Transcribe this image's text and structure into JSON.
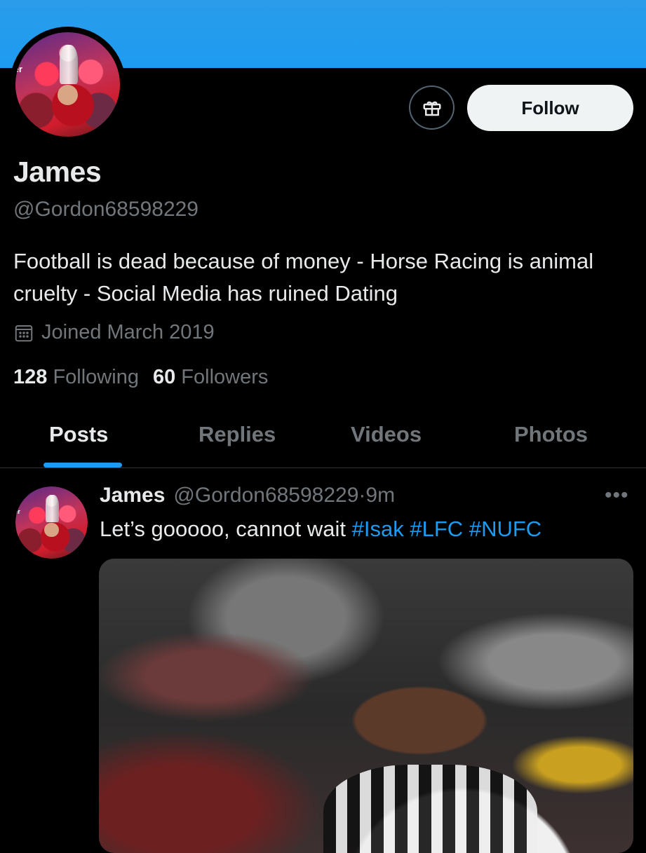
{
  "profile": {
    "name": "James",
    "handle": "@Gordon68598229",
    "bio": "Football is dead because of money - Horse Racing is animal cruelty - Social Media has ruined Dating",
    "joined": "Joined March 2019",
    "following_count": "128",
    "following_label": "Following",
    "followers_count": "60",
    "followers_label": "Followers",
    "follow_button": "Follow",
    "avatar_text": "ier"
  },
  "tabs": [
    {
      "label": "Posts",
      "active": true
    },
    {
      "label": "Replies",
      "active": false
    },
    {
      "label": "Videos",
      "active": false
    },
    {
      "label": "Photos",
      "active": false
    }
  ],
  "post": {
    "name": "James",
    "handle": "@Gordon68598229",
    "separator": "·",
    "time": "9m",
    "text": "Let’s gooooo, cannot wait",
    "hashtags": [
      "#Isak",
      "#LFC",
      "#NUFC"
    ],
    "more": "•••"
  },
  "icons": {
    "gift": "gift-icon",
    "calendar": "calendar-icon",
    "more": "more-icon"
  },
  "colors": {
    "banner": "#1d9bf0",
    "accent": "#1d9bf0",
    "background": "#000000",
    "text": "#e7e9ea",
    "muted": "#71767b",
    "follow_bg": "#eff3f4"
  }
}
